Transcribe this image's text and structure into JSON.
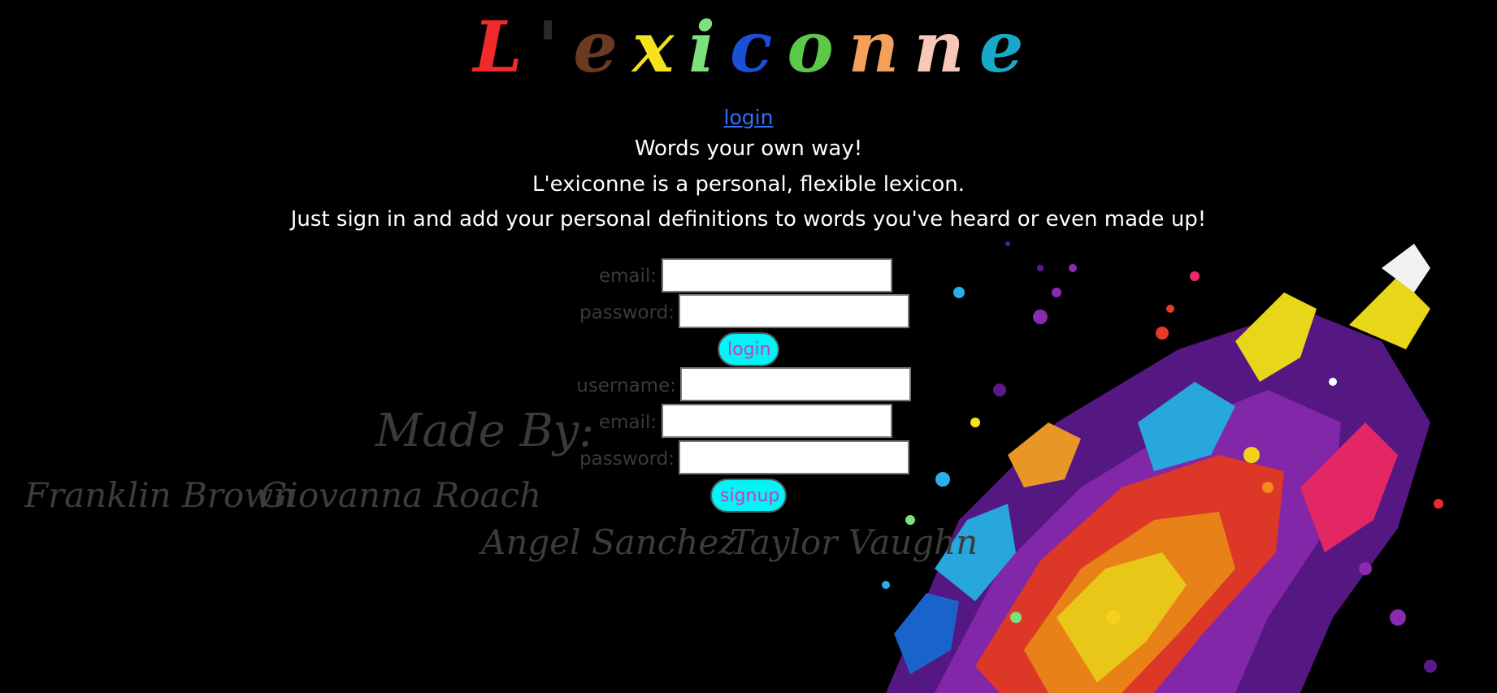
{
  "header": {
    "title_letters": [
      {
        "ch": "L",
        "color": "#f02a2a"
      },
      {
        "ch": "'",
        "color": "#2a2a2a"
      },
      {
        "ch": "e",
        "color": "#6b3a22"
      },
      {
        "ch": "x",
        "color": "#f5e21a"
      },
      {
        "ch": "i",
        "color": "#7de07d"
      },
      {
        "ch": "c",
        "color": "#1a4fd6"
      },
      {
        "ch": "o",
        "color": "#5cc84a"
      },
      {
        "ch": "n",
        "color": "#f5a05a"
      },
      {
        "ch": "n",
        "color": "#f7c8b8"
      },
      {
        "ch": "e",
        "color": "#1aa8c8"
      }
    ],
    "login_link": "login"
  },
  "intro": {
    "tagline": "Words your own way!",
    "description": "L'exiconne is a personal, flexible lexicon.",
    "instructions": "Just sign in and add your personal definitions to words you've heard or even made up!"
  },
  "login_form": {
    "email_label": "email:",
    "password_label": "password:",
    "email_value": "",
    "password_value": "",
    "submit_label": "login"
  },
  "signup_form": {
    "username_label": "username:",
    "email_label": "email:",
    "password_label": "password:",
    "username_value": "",
    "email_value": "",
    "password_value": "",
    "submit_label": "signup"
  },
  "credits": {
    "heading": "Made By:",
    "authors": [
      "Franklin Brown",
      "Giovanna Roach",
      "Angel Sanchez",
      "Taylor Vaughn"
    ]
  },
  "colors": {
    "background": "#000000",
    "link": "#2f6fff",
    "button_bg": "#00f5f5",
    "button_text": "#c03fc0",
    "label_text": "#3a3a3a"
  }
}
